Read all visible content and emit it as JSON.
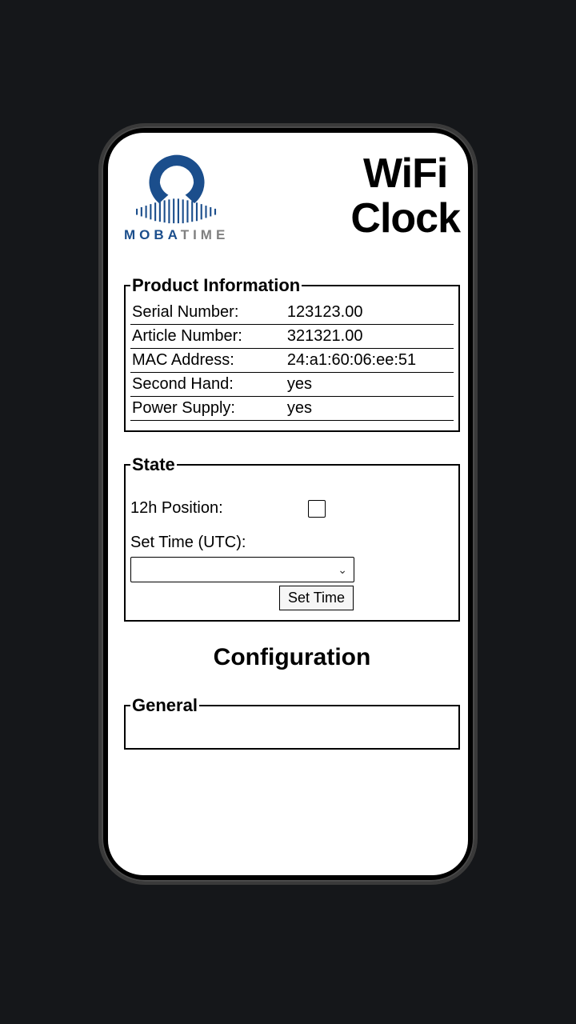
{
  "header": {
    "logo_text_main": "MOBA",
    "logo_text_sub": "TIME",
    "title_line1": "WiFi",
    "title_line2": "Clock"
  },
  "product_info": {
    "legend": "Product Information",
    "rows": [
      {
        "label": "Serial Number:",
        "value": "123123.00"
      },
      {
        "label": "Article Number:",
        "value": "321321.00"
      },
      {
        "label": "MAC Address:",
        "value": "24:a1:60:06:ee:51"
      },
      {
        "label": "Second Hand:",
        "value": "yes"
      },
      {
        "label": "Power Supply:",
        "value": "yes"
      }
    ]
  },
  "state": {
    "legend": "State",
    "pos_label": "12h Position:",
    "pos_checked": false,
    "set_time_label": "Set Time (UTC):",
    "set_time_value": "",
    "set_time_button": "Set Time"
  },
  "configuration": {
    "heading": "Configuration"
  },
  "general": {
    "legend": "General"
  }
}
